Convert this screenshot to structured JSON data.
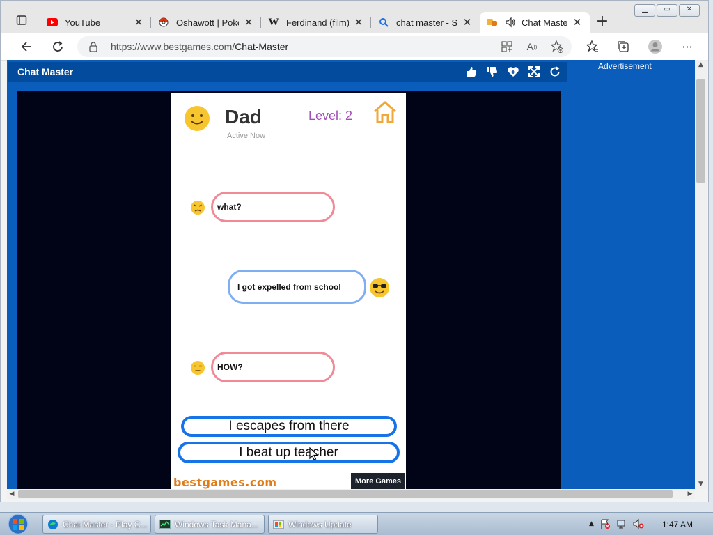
{
  "browser": {
    "tabs": [
      {
        "title": "YouTube",
        "icon": "youtube-icon"
      },
      {
        "title": "Oshawott | Pokémon",
        "icon": "pokeball-icon"
      },
      {
        "title": "Ferdinand (film) -",
        "icon": "wikipedia-icon"
      },
      {
        "title": "chat master - Sea",
        "icon": "search-icon"
      },
      {
        "title": "Chat Master",
        "icon": "bestgames-icon",
        "active": true
      }
    ],
    "address": {
      "prefix": "https://www.bestgames.com/",
      "path": "Chat-Master"
    }
  },
  "page": {
    "game_title": "Chat Master",
    "ad_label": "Advertisement"
  },
  "game": {
    "contact_name": "Dad",
    "contact_status": "Active Now",
    "level_label": "Level: 2",
    "messages": [
      {
        "from": "dad",
        "text": "what?"
      },
      {
        "from": "me",
        "text": "I got expelled from school"
      },
      {
        "from": "dad",
        "text": "HOW?"
      }
    ],
    "choices": [
      "I escapes from there",
      "I beat up teacher"
    ],
    "brand": "bestgames.com",
    "more_games": "More Games"
  },
  "taskbar": {
    "items": [
      {
        "label": "Chat Master - Play C...",
        "icon": "edge-icon"
      },
      {
        "label": "Windows Task Mana...",
        "icon": "task-manager-icon"
      },
      {
        "label": "Windows Update",
        "icon": "windows-update-icon"
      }
    ],
    "clock": "1:47 AM"
  },
  "colors": {
    "page_blue": "#0a5dbb",
    "header_blue": "#034c9d",
    "game_bg": "#010317",
    "incoming_bubble": "#f08a96",
    "outgoing_bubble": "#80aef2",
    "choice_border": "#1773e8",
    "level_purple": "#a24fb5"
  }
}
